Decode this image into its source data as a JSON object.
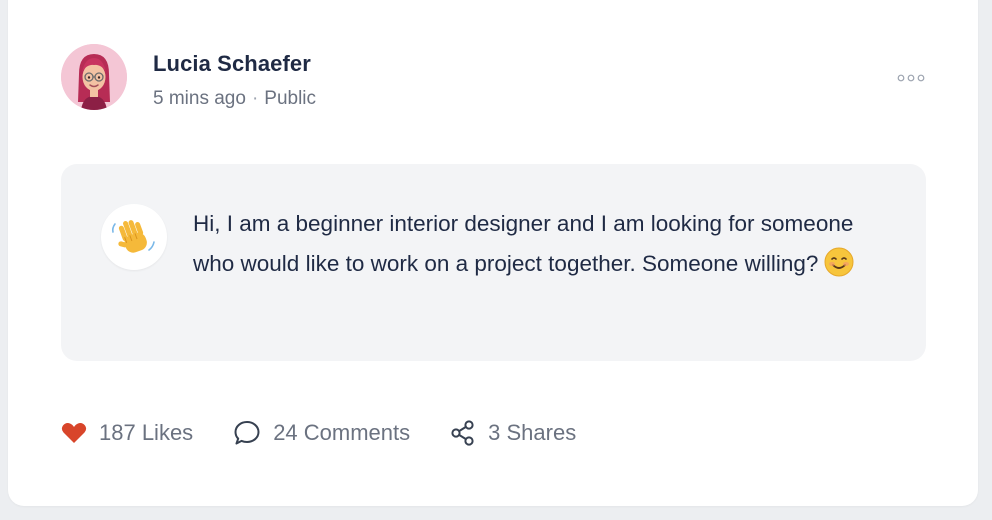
{
  "post": {
    "author": "Lucia Schaefer",
    "time": "5 mins ago",
    "separator": "·",
    "visibility": "Public",
    "message": "Hi, I am a beginner interior designer and I am looking for someone who would like to work on a project together. Someone willing?"
  },
  "actions": {
    "likes_label": "187 Likes",
    "comments_label": "24 Comments",
    "shares_label": "3 Shares"
  },
  "icons": {
    "more": "more-horizontal-icon",
    "heart": "heart-icon",
    "comment": "comment-bubble-icon",
    "share": "share-icon",
    "wave": "waving-hand-emoji",
    "smile": "smiling-face-emoji"
  },
  "colors": {
    "heart": "#d8452a",
    "text_primary": "#1f2a44",
    "text_muted": "#6b7280",
    "bubble_bg": "#f3f4f6",
    "avatar_bg": "#f4c6d5"
  }
}
